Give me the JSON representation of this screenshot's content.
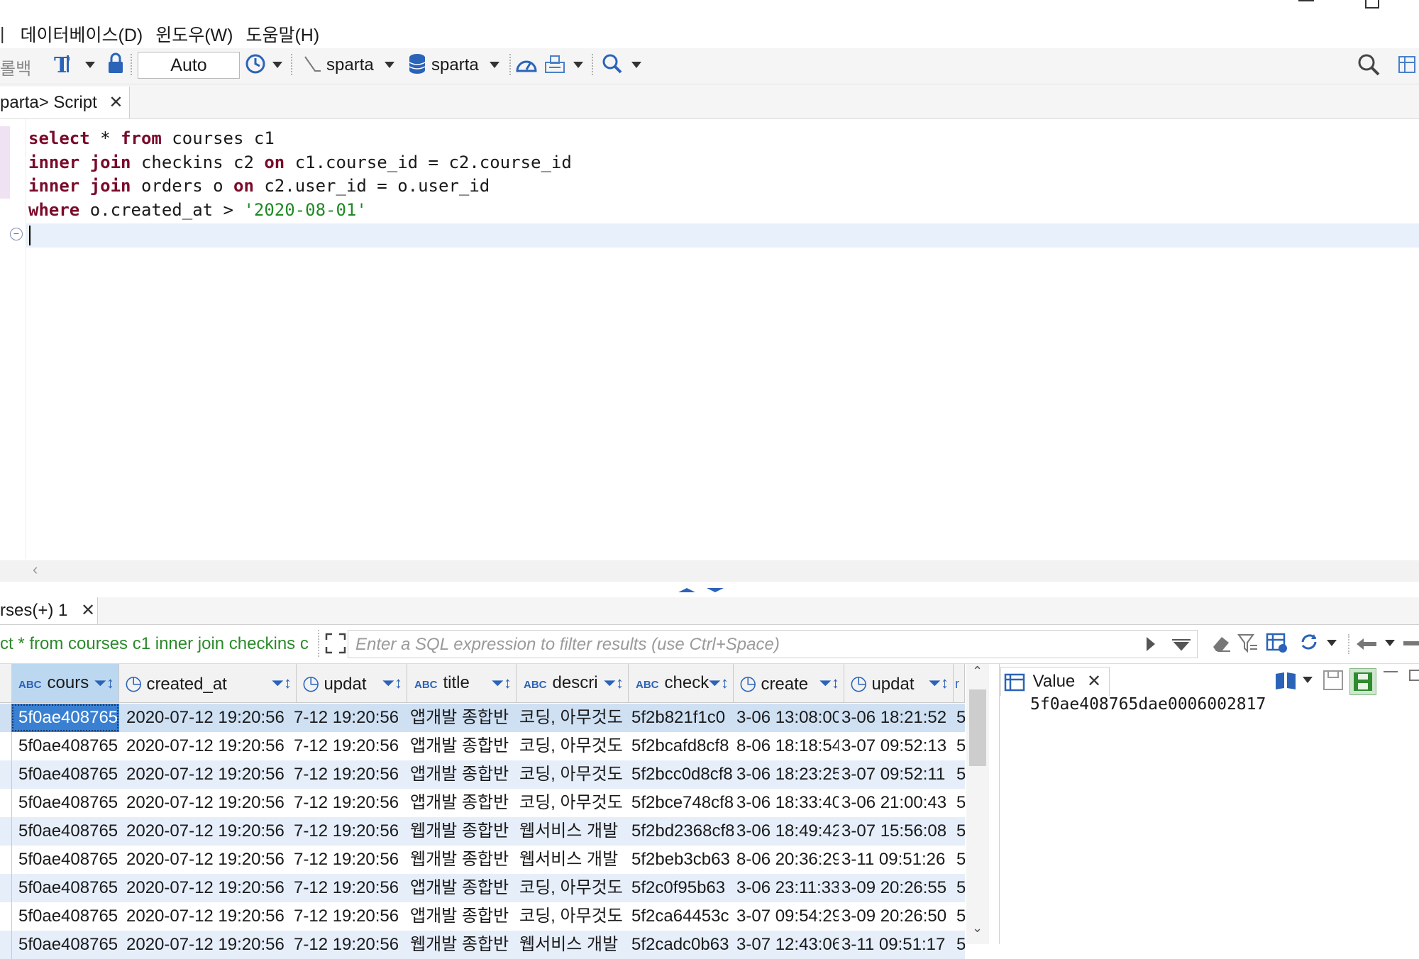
{
  "menu": {
    "items": [
      "데이터베이스(D)",
      "윈도우(W)",
      "도움말(H)"
    ]
  },
  "toolbar": {
    "rollback_label": "롤백",
    "mode_value": "Auto",
    "datasource_label": "sparta",
    "schema_label": "sparta"
  },
  "editor_tab": {
    "label": "parta> Script"
  },
  "editor": {
    "lines": [
      [
        {
          "t": "select",
          "c": "kw"
        },
        {
          "t": " * ",
          "c": ""
        },
        {
          "t": "from",
          "c": "kw"
        },
        {
          "t": " courses c1",
          "c": ""
        }
      ],
      [
        {
          "t": "inner join",
          "c": "kw"
        },
        {
          "t": " checkins c2 ",
          "c": ""
        },
        {
          "t": "on",
          "c": "kw"
        },
        {
          "t": " c1.course_id = c2.course_id",
          "c": ""
        }
      ],
      [
        {
          "t": "inner join",
          "c": "kw"
        },
        {
          "t": " orders o ",
          "c": ""
        },
        {
          "t": "on",
          "c": "kw"
        },
        {
          "t": " c2.user_id = o.user_id",
          "c": ""
        }
      ],
      [
        {
          "t": "where",
          "c": "kw"
        },
        {
          "t": " o.created_at > ",
          "c": ""
        },
        {
          "t": "'2020-08-01'",
          "c": "str"
        }
      ]
    ]
  },
  "results_tab": {
    "label": "rses(+) 1"
  },
  "filter": {
    "query_text": "ct * from courses c1 inner join checkins c",
    "placeholder": "Enter a SQL expression to filter results (use Ctrl+Space)"
  },
  "grid": {
    "columns": [
      {
        "type": "ABC",
        "label": "cours",
        "selected": true
      },
      {
        "type": "clock",
        "label": "created_at"
      },
      {
        "type": "clock",
        "label": "updat"
      },
      {
        "type": "ABC",
        "label": "title"
      },
      {
        "type": "ABC",
        "label": "descri"
      },
      {
        "type": "ABC",
        "label": "check"
      },
      {
        "type": "clock",
        "label": "create"
      },
      {
        "type": "clock",
        "label": "updat"
      },
      {
        "type": "",
        "label": "r"
      }
    ],
    "rows": [
      [
        "5f0ae408765",
        "2020-07-12 19:20:56",
        "7-12 19:20:56",
        "앱개발 종합반",
        "코딩, 아무것도",
        "5f2b821f1c0",
        "3-06 13:08:00",
        "3-06 18:21:52",
        "5"
      ],
      [
        "5f0ae408765",
        "2020-07-12 19:20:56",
        "7-12 19:20:56",
        "앱개발 종합반",
        "코딩, 아무것도",
        "5f2bcafd8cf8",
        "8-06 18:18:54",
        "3-07 09:52:13",
        "5"
      ],
      [
        "5f0ae408765",
        "2020-07-12 19:20:56",
        "7-12 19:20:56",
        "앱개발 종합반",
        "코딩, 아무것도",
        "5f2bcc0d8cf8",
        "3-06 18:23:25",
        "3-07 09:52:11",
        "5"
      ],
      [
        "5f0ae408765",
        "2020-07-12 19:20:56",
        "7-12 19:20:56",
        "앱개발 종합반",
        "코딩, 아무것도",
        "5f2bce748cf8",
        "3-06 18:33:40",
        "3-06 21:00:43",
        "5"
      ],
      [
        "5f0ae408765",
        "2020-07-12 19:20:56",
        "7-12 19:20:56",
        "웹개발 종합반",
        "웹서비스 개발",
        "5f2bd2368cf8",
        "3-06 18:49:42",
        "3-07 15:56:08",
        "5"
      ],
      [
        "5f0ae408765",
        "2020-07-12 19:20:56",
        "7-12 19:20:56",
        "웹개발 종합반",
        "웹서비스 개발",
        "5f2beb3cb63",
        "8-06 20:36:29",
        "3-11 09:51:26",
        "5"
      ],
      [
        "5f0ae408765",
        "2020-07-12 19:20:56",
        "7-12 19:20:56",
        "앱개발 종합반",
        "코딩, 아무것도",
        "5f2c0f95b63",
        "3-06 23:11:33",
        "3-09 20:26:55",
        "5"
      ],
      [
        "5f0ae408765",
        "2020-07-12 19:20:56",
        "7-12 19:20:56",
        "앱개발 종합반",
        "코딩, 아무것도",
        "5f2ca64453c",
        "3-07 09:54:29",
        "3-09 20:26:50",
        "5"
      ],
      [
        "5f0ae408765",
        "2020-07-12 19:20:56",
        "7-12 19:20:56",
        "웹개발 종합반",
        "웹서비스 개발",
        "5f2cadc0b63",
        "3-07 12:43:06",
        "3-11 09:51:17",
        "5"
      ]
    ]
  },
  "value_panel": {
    "tab_label": "Value",
    "value": "5f0ae408765dae0006002817"
  },
  "colors": {
    "keyword": "#7a0a2a",
    "string": "#1e8a23",
    "selection": "#bcd7f0",
    "row_alt": "#e6eefa"
  }
}
